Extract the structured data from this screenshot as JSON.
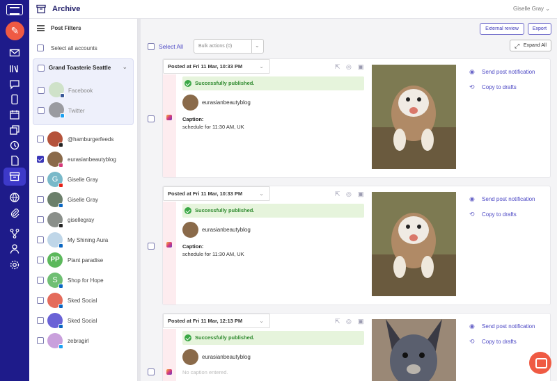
{
  "colors": {
    "rail": "#1e1b8a",
    "accent": "#3b37b8",
    "compose": "#ef5a43",
    "success_bg": "#e6f4dc",
    "success_text": "#2f8a2f"
  },
  "header": {
    "title": "Archive",
    "user": "Giselle Gray"
  },
  "rail": {
    "icons": [
      "logo-icon",
      "compose-icon",
      "inbox-icon",
      "library-icon",
      "chat-icon",
      "mobile-icon",
      "calendar-icon",
      "gallery-icon",
      "history-icon",
      "document-icon",
      "archive-icon",
      "analytics-icon",
      "attachment-icon",
      "workflow-icon",
      "user-icon",
      "settings-icon"
    ]
  },
  "filters": {
    "title": "Post Filters",
    "select_all_accounts": "Select all accounts",
    "group": {
      "name": "Grand Toasterie Seattle",
      "items": [
        {
          "label": "Facebook"
        },
        {
          "label": "Twitter"
        }
      ]
    },
    "accounts": [
      {
        "label": "@hamburgerfeeds",
        "checked": false,
        "network": "tiktok"
      },
      {
        "label": "eurasianbeautyblog",
        "checked": true,
        "network": "instagram"
      },
      {
        "label": "Giselle Gray",
        "checked": false,
        "network": "youtube"
      },
      {
        "label": "Giselle Gray",
        "checked": false,
        "network": "linkedin"
      },
      {
        "label": "gisellegray",
        "checked": false,
        "network": "tiktok"
      },
      {
        "label": "My Shining Aura",
        "checked": false,
        "network": "linkedin"
      },
      {
        "label": "Plant paradise",
        "checked": false,
        "network": "google"
      },
      {
        "label": "Shop for Hope",
        "checked": false,
        "network": "linkedin"
      },
      {
        "label": "Sked Social",
        "checked": false,
        "network": "linkedin"
      },
      {
        "label": "Sked Social",
        "checked": false,
        "network": "linkedin"
      },
      {
        "label": "zebragirl",
        "checked": false,
        "network": "twitter"
      }
    ]
  },
  "toolbar": {
    "external_review": "External review",
    "export": "Export",
    "select_all": "Select All",
    "bulk_actions": "Bulk actions (0)",
    "expand_all": "Expand All"
  },
  "posts": [
    {
      "posted": "Posted at Fri 11 Mar, 10:33 PM",
      "status": "Successfully published.",
      "account": "eurasianbeautyblog",
      "caption_label": "Caption:",
      "caption": "schedule for 11:30 AM, UK",
      "actions": [
        "Send post notification",
        "Copy to drafts"
      ]
    },
    {
      "posted": "Posted at Fri 11 Mar, 10:33 PM",
      "status": "Successfully published.",
      "account": "eurasianbeautyblog",
      "caption_label": "Caption:",
      "caption": "schedule for 11:30 AM, UK",
      "actions": [
        "Send post notification",
        "Copy to drafts"
      ]
    },
    {
      "posted": "Posted at Fri 11 Mar, 12:13 PM",
      "status": "Successfully published.",
      "account": "eurasianbeautyblog",
      "caption_label": "",
      "caption": "No caption entered.",
      "actions": [
        "Send post notification",
        "Copy to drafts"
      ]
    }
  ]
}
